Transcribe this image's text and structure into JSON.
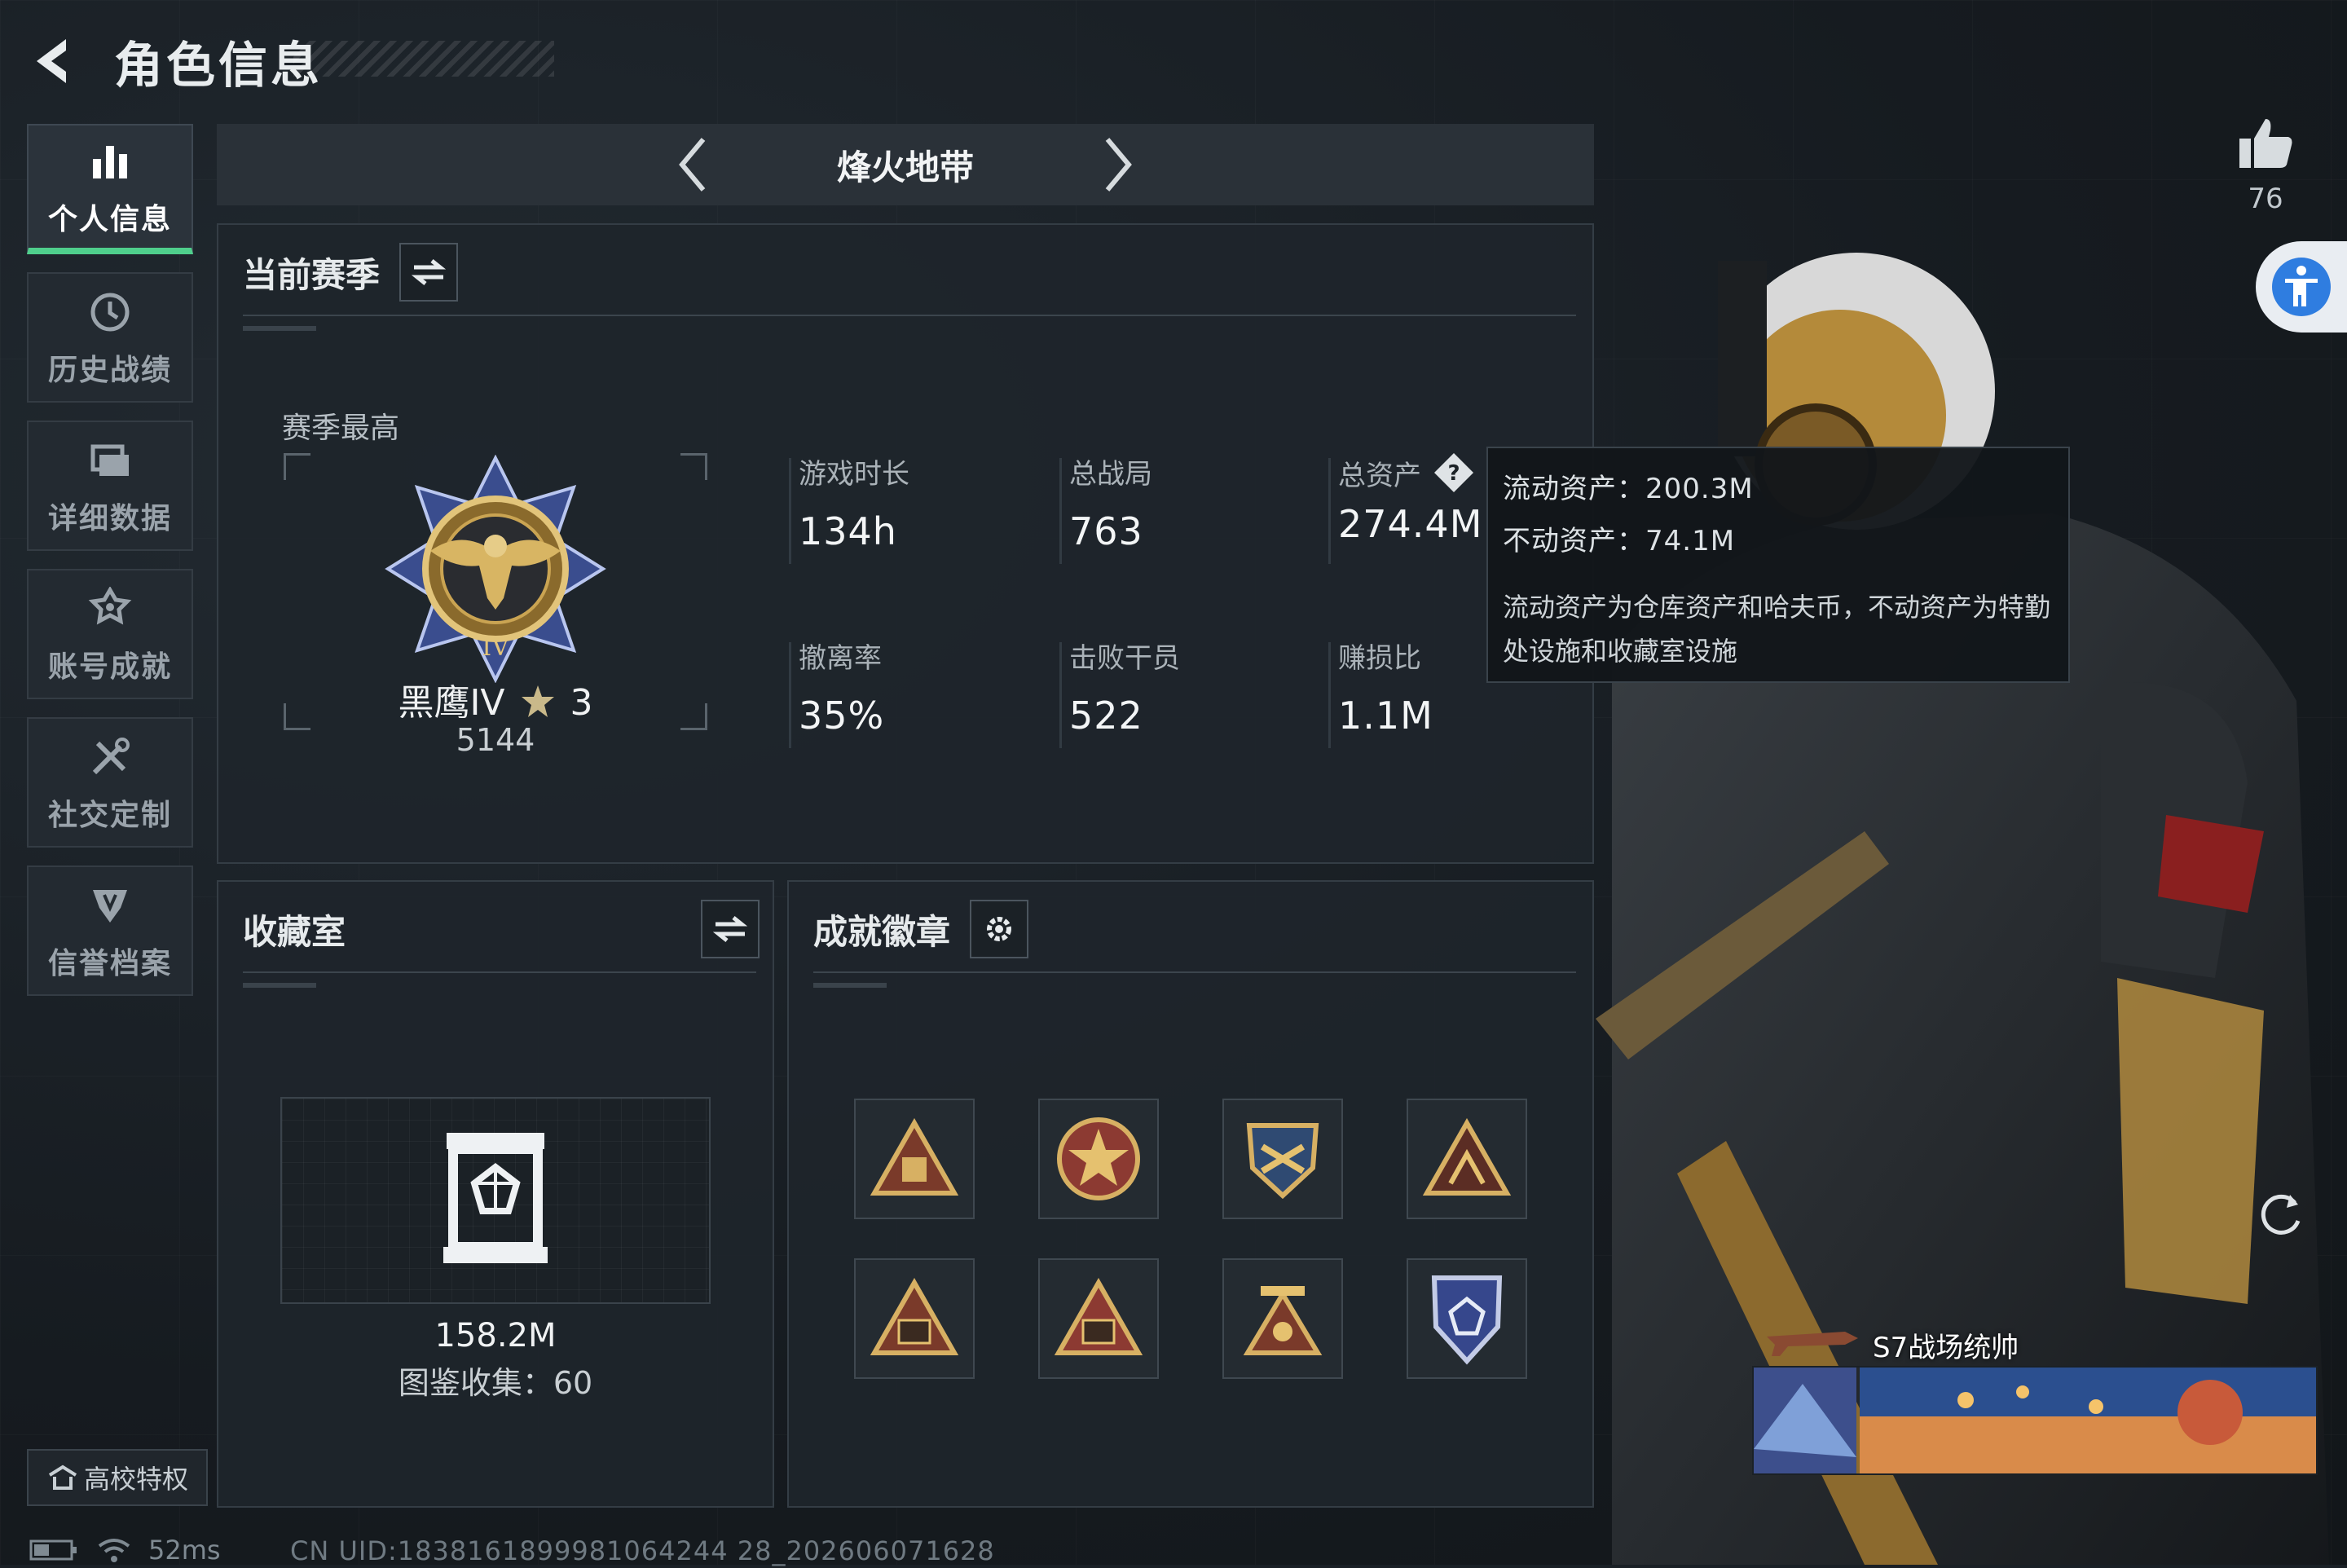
{
  "header": {
    "title": "角色信息"
  },
  "sidebar": {
    "items": [
      {
        "label": "个人信息",
        "icon": "bar-chart-icon",
        "active": true
      },
      {
        "label": "历史战绩",
        "icon": "history-icon",
        "active": false
      },
      {
        "label": "详细数据",
        "icon": "folder-icon",
        "active": false
      },
      {
        "label": "账号成就",
        "icon": "achievement-icon",
        "active": false
      },
      {
        "label": "社交定制",
        "icon": "tools-icon",
        "active": false
      },
      {
        "label": "信誉档案",
        "icon": "shield-icon",
        "active": false
      }
    ],
    "campus_label": "高校特权"
  },
  "mode": {
    "title": "烽火地带"
  },
  "season": {
    "title": "当前赛季",
    "best_label": "赛季最高",
    "rank_name": "黑鹰IV",
    "rank_stars": "3",
    "rank_score": "5144",
    "stats": [
      {
        "label": "游戏时长",
        "value": "134h"
      },
      {
        "label": "总战局",
        "value": "763"
      },
      {
        "label": "总资产",
        "value": "274.4M"
      },
      {
        "label": "撤离率",
        "value": "35%"
      },
      {
        "label": "击败干员",
        "value": "522"
      },
      {
        "label": "赚损比",
        "value": "1.1M"
      }
    ]
  },
  "tooltip": {
    "liquid": "流动资产：200.3M",
    "fixed": "不动资产：74.1M",
    "note": "流动资产为仓库资产和哈夫币，不动资产为特勤处设施和收藏室设施"
  },
  "collection": {
    "title": "收藏室",
    "value": "158.2M",
    "count_text": "图鉴收集：60"
  },
  "badges": {
    "title": "成就徽章",
    "items": [
      "triangle-badge-icon",
      "star-seal-badge-icon",
      "shield-badge-icon",
      "tri-crest-badge-icon",
      "s7-badge-icon",
      "s8-badge-icon",
      "s9-badge-icon",
      "blue-shield-badge-icon"
    ]
  },
  "social": {
    "likes": "76"
  },
  "card": {
    "name": "S7战场统帅"
  },
  "status": {
    "ping": "52ms",
    "uid": "CN UID:1838161899981064244 28_202606071628"
  },
  "colors": {
    "accent_green": "#4fcf8c",
    "access_blue": "#2f7de0",
    "gold": "#c9a24b"
  }
}
